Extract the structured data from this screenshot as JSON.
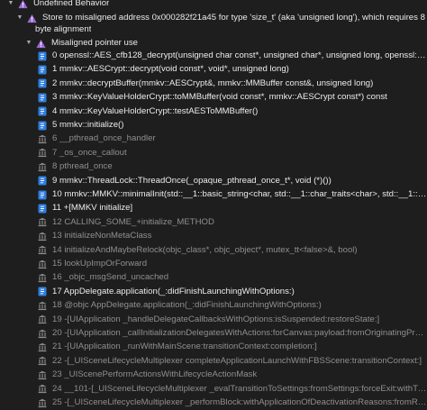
{
  "colors": {
    "background": "#1e1e1e",
    "warning_purple": "#9b6bd3",
    "text_primary": "#ececec",
    "text_dim": "#8f8f8f",
    "user_frame_icon": "#2f7fe0"
  },
  "issue": {
    "category": "Undefined Behavior",
    "message": "Store to misaligned address 0x000282f21a45 for type 'size_t' (aka 'unsigned long'), which requires 8",
    "message_cont": "byte alignment",
    "subgroup": "Misaligned pointer use",
    "icon": "purple-warning-triangle-icon"
  },
  "frames": [
    {
      "label": "0 openssl::AES_cfb128_decrypt(unsigned char const*, unsigned char*, unsigned long, openssl::AES...",
      "kind": "user"
    },
    {
      "label": "1 mmkv::AESCrypt::decrypt(void const*, void*, unsigned long)",
      "kind": "user"
    },
    {
      "label": "2 mmkv::decryptBuffer(mmkv::AESCrypt&, mmkv::MMBuffer const&, unsigned long)",
      "kind": "user"
    },
    {
      "label": "3 mmkv::KeyValueHolderCrypt::toMMBuffer(void const*, mmkv::AESCrypt const*) const",
      "kind": "user"
    },
    {
      "label": "4 mmkv::KeyValueHolderCrypt::testAESToMMBuffer()",
      "kind": "user"
    },
    {
      "label": "5 mmkv::initialize()",
      "kind": "user"
    },
    {
      "label": "6 __pthread_once_handler",
      "kind": "system"
    },
    {
      "label": "7 _os_once_callout",
      "kind": "system"
    },
    {
      "label": "8 pthread_once",
      "kind": "system"
    },
    {
      "label": "9 mmkv::ThreadLock::ThreadOnce(_opaque_pthread_once_t*, void (*)())",
      "kind": "user"
    },
    {
      "label": "10 mmkv::MMKV::minimalInit(std::__1::basic_string<char, std::__1::char_traits<char>, std::__1::allo...",
      "kind": "user"
    },
    {
      "label": "11 +[MMKV initialize]",
      "kind": "user"
    },
    {
      "label": "12 CALLING_SOME_+initialize_METHOD",
      "kind": "system"
    },
    {
      "label": "13 initializeNonMetaClass",
      "kind": "system"
    },
    {
      "label": "14 initializeAndMaybeRelock(objc_class*, objc_object*, mutex_tt<false>&, bool)",
      "kind": "system"
    },
    {
      "label": "15 lookUpImpOrForward",
      "kind": "system"
    },
    {
      "label": "16 _objc_msgSend_uncached",
      "kind": "system"
    },
    {
      "label": "17 AppDelegate.application(_:didFinishLaunchingWithOptions:)",
      "kind": "user"
    },
    {
      "label": "18 @objc AppDelegate.application(_:didFinishLaunchingWithOptions:)",
      "kind": "system"
    },
    {
      "label": "19 -[UIApplication _handleDelegateCallbacksWithOptions:isSuspended:restoreState:]",
      "kind": "system"
    },
    {
      "label": "20 -[UIApplication _callInitializationDelegatesWithActions:forCanvas:payload:fromOriginatingProc...",
      "kind": "system"
    },
    {
      "label": "21 -[UIApplication _runWithMainScene:transitionContext:completion:]",
      "kind": "system"
    },
    {
      "label": "22 -[_UISceneLifecycleMultiplexer completeApplicationLaunchWithFBSScene:transitionContext:]",
      "kind": "system"
    },
    {
      "label": "23 _UIScenePerformActionsWithLifecycleActionMask",
      "kind": "system"
    },
    {
      "label": "24 __101-[_UISceneLifecycleMultiplexer _evalTransitionToSettings:fromSettings:forceExit:withTransit...",
      "kind": "system"
    },
    {
      "label": "25 -[_UISceneLifecycleMultiplexer _performBlock:withApplicationOfDeactivationReasons:fromReason...",
      "kind": "system"
    }
  ]
}
